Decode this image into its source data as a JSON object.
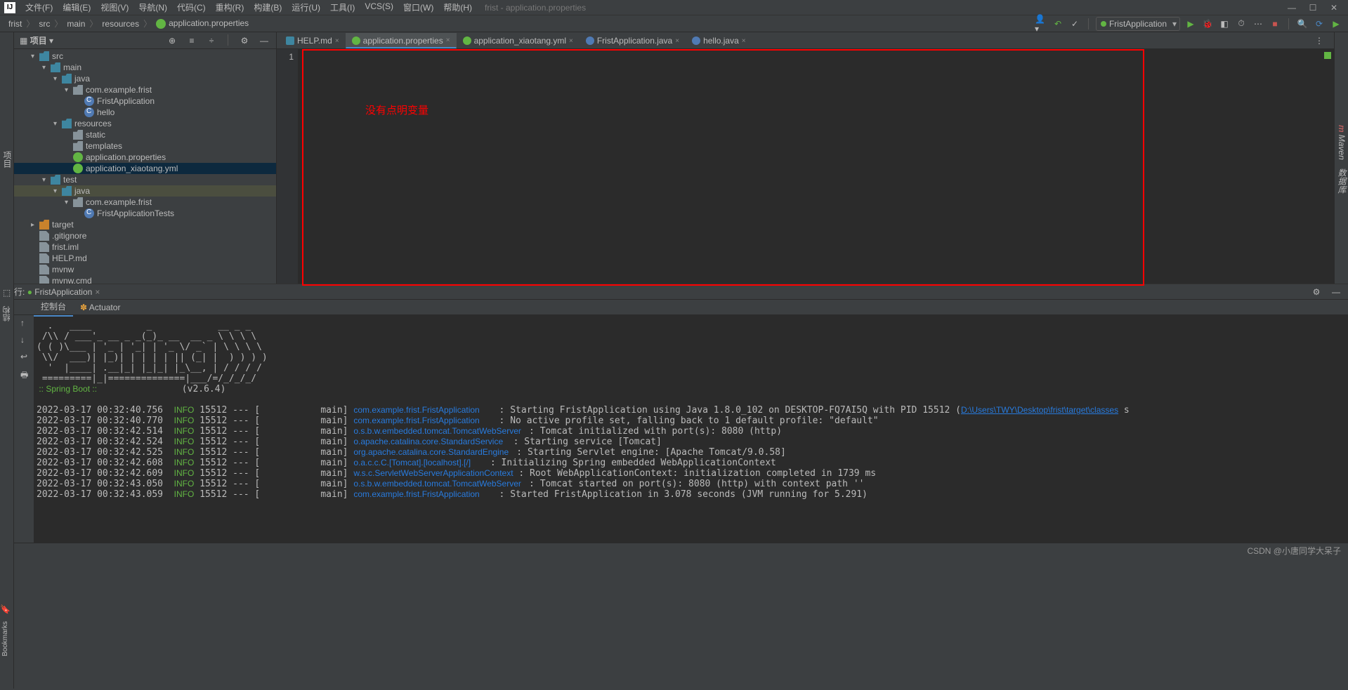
{
  "menu": {
    "file": "文件(F)",
    "edit": "编辑(E)",
    "view": "视图(V)",
    "nav": "导航(N)",
    "code": "代码(C)",
    "refactor": "重构(R)",
    "build": "构建(B)",
    "run": "运行(U)",
    "tools": "工具(I)",
    "vcs": "VCS(S)",
    "window": "窗口(W)",
    "help": "帮助(H)"
  },
  "title": "frist - application.properties",
  "breadcrumb": [
    "frist",
    "src",
    "main",
    "resources",
    "application.properties"
  ],
  "run_config": "FristApplication",
  "project_panel_title": "项目",
  "left_gutter": "项目",
  "right_gutter": {
    "m": "m",
    "maven": "Maven",
    "db": "数据库"
  },
  "tree": [
    {
      "d": 1,
      "a": "▾",
      "ic": "folder blue",
      "t": "src"
    },
    {
      "d": 2,
      "a": "▾",
      "ic": "folder blue",
      "t": "main"
    },
    {
      "d": 3,
      "a": "▾",
      "ic": "folder blue",
      "t": "java"
    },
    {
      "d": 4,
      "a": "▾",
      "ic": "folder",
      "t": "com.example.frist"
    },
    {
      "d": 5,
      "a": "",
      "ic": "jclass",
      "t": "FristApplication"
    },
    {
      "d": 5,
      "a": "",
      "ic": "jclass",
      "t": "hello"
    },
    {
      "d": 3,
      "a": "▾",
      "ic": "folder blue",
      "t": "resources"
    },
    {
      "d": 4,
      "a": "",
      "ic": "folder",
      "t": "static"
    },
    {
      "d": 4,
      "a": "",
      "ic": "folder",
      "t": "templates"
    },
    {
      "d": 4,
      "a": "",
      "ic": "spring",
      "t": "application.properties"
    },
    {
      "d": 4,
      "a": "",
      "ic": "spring",
      "t": "application_xiaotang.yml",
      "sel": true
    },
    {
      "d": 2,
      "a": "▾",
      "ic": "folder blue",
      "t": "test"
    },
    {
      "d": 3,
      "a": "▾",
      "ic": "folder blue",
      "t": "java",
      "hl": true
    },
    {
      "d": 4,
      "a": "▾",
      "ic": "folder",
      "t": "com.example.frist"
    },
    {
      "d": 5,
      "a": "",
      "ic": "jclass",
      "t": "FristApplicationTests"
    },
    {
      "d": 1,
      "a": "▸",
      "ic": "folder orange",
      "t": "target"
    },
    {
      "d": 1,
      "a": "",
      "ic": "fileic",
      "t": ".gitignore"
    },
    {
      "d": 1,
      "a": "",
      "ic": "fileic",
      "t": "frist.iml"
    },
    {
      "d": 1,
      "a": "",
      "ic": "fileic",
      "t": "HELP.md"
    },
    {
      "d": 1,
      "a": "",
      "ic": "fileic",
      "t": "mvnw"
    },
    {
      "d": 1,
      "a": "",
      "ic": "fileic",
      "t": "mvnw.cmd"
    }
  ],
  "tabs": [
    {
      "ic": "md",
      "t": "HELP.md"
    },
    {
      "ic": "grn",
      "t": "application.properties",
      "active": true
    },
    {
      "ic": "grn",
      "t": "application_xiaotang.yml"
    },
    {
      "ic": "blu",
      "t": "FristApplication.java"
    },
    {
      "ic": "blu",
      "t": "hello.java"
    }
  ],
  "annotation": "没有点明变量",
  "line_num": "1",
  "run_header": "运行:",
  "run_header_tab": "FristApplication",
  "run_tabs": {
    "console": "控制台",
    "actuator": "Actuator"
  },
  "springboot": " :: Spring Boot :: ",
  "sb_ver": "(v2.6.4)",
  "log": [
    {
      "ts": "2022-03-17 00:32:40.756",
      "lv": "INFO",
      "pid": "15512",
      "th": "main",
      "cls": "com.example.frist.FristApplication",
      "msg": "Starting FristApplication using Java 1.8.0_102 on DESKTOP-FQ7AI5Q with PID 15512 (",
      "link": "D:\\Users\\TWY\\Desktop\\frist\\target\\classes",
      "tail": " s"
    },
    {
      "ts": "2022-03-17 00:32:40.770",
      "lv": "INFO",
      "pid": "15512",
      "th": "main",
      "cls": "com.example.frist.FristApplication",
      "msg": "No active profile set, falling back to 1 default profile: \"default\""
    },
    {
      "ts": "2022-03-17 00:32:42.514",
      "lv": "INFO",
      "pid": "15512",
      "th": "main",
      "cls": "o.s.b.w.embedded.tomcat.TomcatWebServer",
      "msg": "Tomcat initialized with port(s): 8080 (http)"
    },
    {
      "ts": "2022-03-17 00:32:42.524",
      "lv": "INFO",
      "pid": "15512",
      "th": "main",
      "cls": "o.apache.catalina.core.StandardService",
      "msg": "Starting service [Tomcat]"
    },
    {
      "ts": "2022-03-17 00:32:42.525",
      "lv": "INFO",
      "pid": "15512",
      "th": "main",
      "cls": "org.apache.catalina.core.StandardEngine",
      "msg": "Starting Servlet engine: [Apache Tomcat/9.0.58]"
    },
    {
      "ts": "2022-03-17 00:32:42.608",
      "lv": "INFO",
      "pid": "15512",
      "th": "main",
      "cls": "o.a.c.c.C.[Tomcat].[localhost].[/]",
      "msg": "Initializing Spring embedded WebApplicationContext"
    },
    {
      "ts": "2022-03-17 00:32:42.609",
      "lv": "INFO",
      "pid": "15512",
      "th": "main",
      "cls": "w.s.c.ServletWebServerApplicationContext",
      "msg": "Root WebApplicationContext: initialization completed in 1739 ms"
    },
    {
      "ts": "2022-03-17 00:32:43.050",
      "lv": "INFO",
      "pid": "15512",
      "th": "main",
      "cls": "o.s.b.w.embedded.tomcat.TomcatWebServer",
      "msg": "Tomcat started on port(s): 8080 (http) with context path ''"
    },
    {
      "ts": "2022-03-17 00:32:43.059",
      "lv": "INFO",
      "pid": "15512",
      "th": "main",
      "cls": "com.example.frist.FristApplication",
      "msg": "Started FristApplication in 3.078 seconds (JVM running for 5.291)"
    }
  ],
  "banner": [
    "  .   ____          _            __ _ _",
    " /\\\\ / ___'_ __ _ _(_)_ __  __ _ \\ \\ \\ \\",
    "( ( )\\___ | '_ | '_| | '_ \\/ _` | \\ \\ \\ \\",
    " \\\\/  ___)| |_)| | | | | || (_| |  ) ) ) )",
    "  '  |____| .__|_| |_|_| |_\\__, | / / / /",
    " =========|_|==============|___/=/_/_/_/"
  ],
  "watermark": "CSDN @小唐同学大呆子",
  "side_labels": {
    "structure": "结构",
    "bookmarks": "Bookmarks"
  }
}
